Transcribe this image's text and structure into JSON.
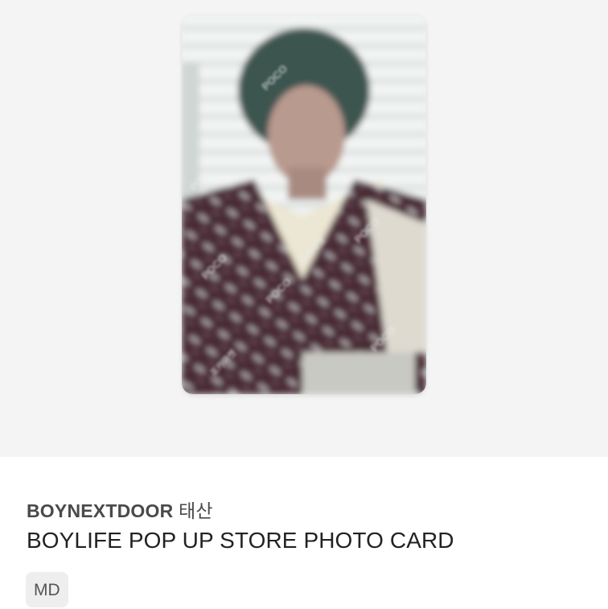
{
  "product": {
    "image_alt": "photocard",
    "brand": "BOYNEXTDOOR",
    "member": "태산",
    "title": "BOYLIFE POP UP STORE PHOTO CARD",
    "category_tag": "MD"
  },
  "watermark": {
    "text": "POCO",
    "text_ko": "포카마켓"
  },
  "colors": {
    "hero_bg": "#f4f4f4",
    "tag_bg": "#eeeeee",
    "brand_text": "#4a4a4a",
    "title_text": "#222222"
  }
}
